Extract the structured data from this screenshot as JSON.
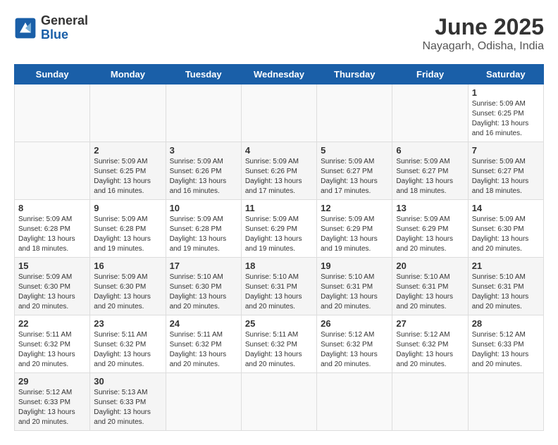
{
  "header": {
    "logo_general": "General",
    "logo_blue": "Blue",
    "title": "June 2025",
    "subtitle": "Nayagarh, Odisha, India"
  },
  "calendar": {
    "days_of_week": [
      "Sunday",
      "Monday",
      "Tuesday",
      "Wednesday",
      "Thursday",
      "Friday",
      "Saturday"
    ],
    "weeks": [
      [
        {
          "day": "",
          "info": ""
        },
        {
          "day": "",
          "info": ""
        },
        {
          "day": "",
          "info": ""
        },
        {
          "day": "",
          "info": ""
        },
        {
          "day": "",
          "info": ""
        },
        {
          "day": "",
          "info": ""
        },
        {
          "day": "1",
          "info": "Sunrise: 5:09 AM\nSunset: 6:25 PM\nDaylight: 13 hours\nand 16 minutes."
        }
      ],
      [
        {
          "day": "",
          "info": ""
        },
        {
          "day": "2",
          "info": "Sunrise: 5:09 AM\nSunset: 6:25 PM\nDaylight: 13 hours\nand 16 minutes."
        },
        {
          "day": "3",
          "info": "Sunrise: 5:09 AM\nSunset: 6:26 PM\nDaylight: 13 hours\nand 16 minutes."
        },
        {
          "day": "4",
          "info": "Sunrise: 5:09 AM\nSunset: 6:26 PM\nDaylight: 13 hours\nand 17 minutes."
        },
        {
          "day": "5",
          "info": "Sunrise: 5:09 AM\nSunset: 6:27 PM\nDaylight: 13 hours\nand 17 minutes."
        },
        {
          "day": "6",
          "info": "Sunrise: 5:09 AM\nSunset: 6:27 PM\nDaylight: 13 hours\nand 18 minutes."
        },
        {
          "day": "7",
          "info": "Sunrise: 5:09 AM\nSunset: 6:27 PM\nDaylight: 13 hours\nand 18 minutes."
        }
      ],
      [
        {
          "day": "8",
          "info": "Sunrise: 5:09 AM\nSunset: 6:28 PM\nDaylight: 13 hours\nand 18 minutes."
        },
        {
          "day": "9",
          "info": "Sunrise: 5:09 AM\nSunset: 6:28 PM\nDaylight: 13 hours\nand 19 minutes."
        },
        {
          "day": "10",
          "info": "Sunrise: 5:09 AM\nSunset: 6:28 PM\nDaylight: 13 hours\nand 19 minutes."
        },
        {
          "day": "11",
          "info": "Sunrise: 5:09 AM\nSunset: 6:29 PM\nDaylight: 13 hours\nand 19 minutes."
        },
        {
          "day": "12",
          "info": "Sunrise: 5:09 AM\nSunset: 6:29 PM\nDaylight: 13 hours\nand 19 minutes."
        },
        {
          "day": "13",
          "info": "Sunrise: 5:09 AM\nSunset: 6:29 PM\nDaylight: 13 hours\nand 20 minutes."
        },
        {
          "day": "14",
          "info": "Sunrise: 5:09 AM\nSunset: 6:30 PM\nDaylight: 13 hours\nand 20 minutes."
        }
      ],
      [
        {
          "day": "15",
          "info": "Sunrise: 5:09 AM\nSunset: 6:30 PM\nDaylight: 13 hours\nand 20 minutes."
        },
        {
          "day": "16",
          "info": "Sunrise: 5:09 AM\nSunset: 6:30 PM\nDaylight: 13 hours\nand 20 minutes."
        },
        {
          "day": "17",
          "info": "Sunrise: 5:10 AM\nSunset: 6:30 PM\nDaylight: 13 hours\nand 20 minutes."
        },
        {
          "day": "18",
          "info": "Sunrise: 5:10 AM\nSunset: 6:31 PM\nDaylight: 13 hours\nand 20 minutes."
        },
        {
          "day": "19",
          "info": "Sunrise: 5:10 AM\nSunset: 6:31 PM\nDaylight: 13 hours\nand 20 minutes."
        },
        {
          "day": "20",
          "info": "Sunrise: 5:10 AM\nSunset: 6:31 PM\nDaylight: 13 hours\nand 20 minutes."
        },
        {
          "day": "21",
          "info": "Sunrise: 5:10 AM\nSunset: 6:31 PM\nDaylight: 13 hours\nand 20 minutes."
        }
      ],
      [
        {
          "day": "22",
          "info": "Sunrise: 5:11 AM\nSunset: 6:32 PM\nDaylight: 13 hours\nand 20 minutes."
        },
        {
          "day": "23",
          "info": "Sunrise: 5:11 AM\nSunset: 6:32 PM\nDaylight: 13 hours\nand 20 minutes."
        },
        {
          "day": "24",
          "info": "Sunrise: 5:11 AM\nSunset: 6:32 PM\nDaylight: 13 hours\nand 20 minutes."
        },
        {
          "day": "25",
          "info": "Sunrise: 5:11 AM\nSunset: 6:32 PM\nDaylight: 13 hours\nand 20 minutes."
        },
        {
          "day": "26",
          "info": "Sunrise: 5:12 AM\nSunset: 6:32 PM\nDaylight: 13 hours\nand 20 minutes."
        },
        {
          "day": "27",
          "info": "Sunrise: 5:12 AM\nSunset: 6:32 PM\nDaylight: 13 hours\nand 20 minutes."
        },
        {
          "day": "28",
          "info": "Sunrise: 5:12 AM\nSunset: 6:33 PM\nDaylight: 13 hours\nand 20 minutes."
        }
      ],
      [
        {
          "day": "29",
          "info": "Sunrise: 5:12 AM\nSunset: 6:33 PM\nDaylight: 13 hours\nand 20 minutes."
        },
        {
          "day": "30",
          "info": "Sunrise: 5:13 AM\nSunset: 6:33 PM\nDaylight: 13 hours\nand 20 minutes."
        },
        {
          "day": "",
          "info": ""
        },
        {
          "day": "",
          "info": ""
        },
        {
          "day": "",
          "info": ""
        },
        {
          "day": "",
          "info": ""
        },
        {
          "day": "",
          "info": ""
        }
      ]
    ]
  }
}
